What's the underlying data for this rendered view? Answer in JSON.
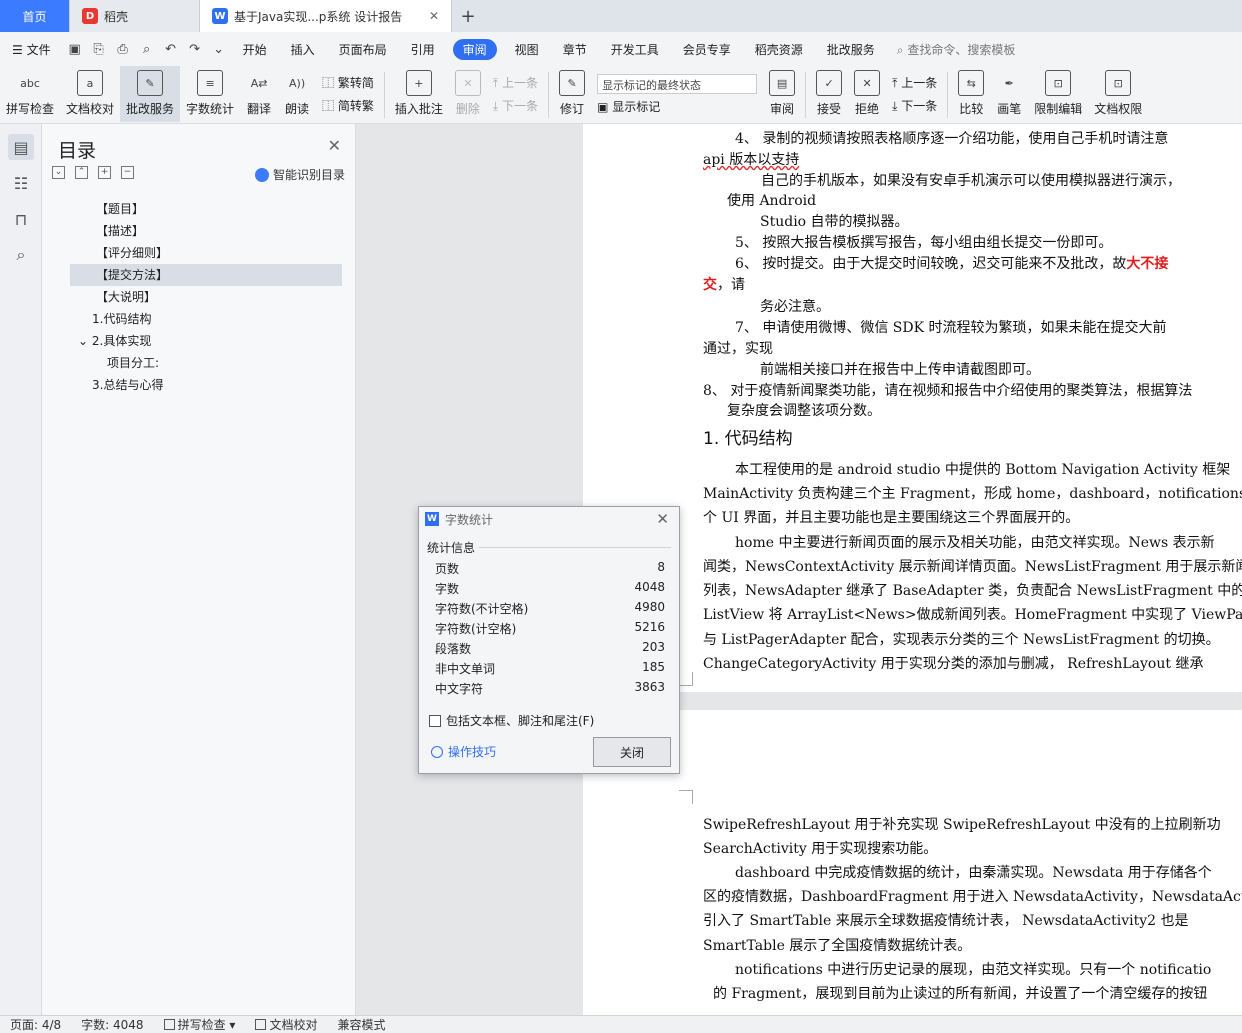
{
  "tabs": {
    "home": "首页",
    "daoke": "稻壳",
    "doc": "基于Java实现...p系统 设计报告"
  },
  "menu": {
    "file": "文件",
    "items": [
      "开始",
      "插入",
      "页面布局",
      "引用",
      "审阅",
      "视图",
      "章节",
      "开发工具",
      "会员专享",
      "稻壳资源",
      "批改服务"
    ],
    "active": "审阅",
    "search": "查找命令、搜索模板"
  },
  "ribbon": {
    "spell": "拼写检查",
    "proof": "文档校对",
    "review_service": "批改服务",
    "wordcount": "字数统计",
    "translate": "翻译",
    "read": "朗读",
    "to_trad": "繁转简",
    "to_simp": "简转繁",
    "insert_comment": "插入批注",
    "delete": "删除",
    "prev": "上一条",
    "next": "下一条",
    "revise": "修订",
    "show_mode": "显示标记的最终状态",
    "show_marks": "显示标记",
    "review": "审阅",
    "accept": "接受",
    "reject": "拒绝",
    "prev2": "上一条",
    "next2": "下一条",
    "compare": "比较",
    "pen": "画笔",
    "restrict": "限制编辑",
    "doc_perm": "文档权限"
  },
  "toc": {
    "title": "目录",
    "smart": "智能识别目录",
    "items": [
      "【题目】",
      "【描述】",
      "【评分细则】",
      "【提交方法】",
      "【大说明】",
      "1.代码结构",
      "2.具体实现",
      "项目分工:",
      "3.总结与心得"
    ]
  },
  "doc": {
    "p1": [
      "4、 录制的视频请按照表格顺序逐一介绍功能，使用自己手机时请注意",
      "api 版本以支持",
      "自己的手机版本，如果没有安卓手机演示可以使用模拟器进行演示，",
      "使用  Android",
      "Studio 自带的模拟器。",
      "5、  按照大报告模板撰写报告，每小组由组长提交一份即可。",
      "6、  按时提交。由于大提交时间较晚，迟交可能来不及批改，故",
      "大不接",
      "交",
      "，请",
      "务必注意。",
      "7、  申请使用微博、微信  SDK 时流程较为繁琐，如果未能在提交大前",
      "通过，实现",
      "前端相关接口并在报告中上传申请截图即可。",
      "8、  对于疫情新闻聚类功能，请在视频和报告中介绍使用的聚类算法，根据算法",
      "复杂度会调整该项分数。"
    ],
    "heading1": "1.  代码结构",
    "p2": [
      "本工程使用的是  android studio 中提供的  Bottom Navigation Activity 框架",
      "MainActivity 负责构建三个主  Fragment，形成 home，dashboard，notifications",
      "个 UI 界面，并且主要功能也是主要围绕这三个界面展开的。",
      "home 中主要进行新闻页面的展示及相关功能，由范文祥实现。News 表示新",
      "闻类，NewsContextActivity 展示新闻详情页面。NewsListFragment 用于展示新闻",
      "列表，NewsAdapter 继承了  BaseAdapter 类，负责配合  NewsListFragment 中的",
      "ListView 将 ArrayList<News>做成新闻列表。HomeFragment 中实现了  ViewPager",
      "与  ListPagerAdapter 配合，实现表示分类的三个  NewsListFragment 的切换。",
      "ChangeCategoryActivity 用于实现分类的添加与删减，  RefreshLayout 继承"
    ],
    "p3": [
      "SwipeRefreshLayout 用于补充实现  SwipeRefreshLayout 中没有的上拉刷新功",
      "SearchActivity 用于实现搜索功能。",
      "dashboard 中完成疫情数据的统计，由秦潇实现。Newsdata 用于存储各个",
      "区的疫情数据，DashboardFragment 用于进入  NewsdataActivity，NewsdataActiv",
      "引入了   SmartTable 来展示全球数据疫情统计表，    NewsdataActivity2 也是",
      "SmartTable 展示了全国疫情数据统计表。",
      "notifications 中进行历史记录的展现，由范文祥实现。只有一个  notificatio",
      "的 Fragment，展现到目前为止读过的所有新闻，并设置了一个清空缓存的按钮"
    ]
  },
  "dialog": {
    "title": "字数统计",
    "section": "统计信息",
    "rows": [
      {
        "label": "页数",
        "value": "8"
      },
      {
        "label": "字数",
        "value": "4048"
      },
      {
        "label": "字符数(不计空格)",
        "value": "4980"
      },
      {
        "label": "字符数(计空格)",
        "value": "5216"
      },
      {
        "label": "段落数",
        "value": "203"
      },
      {
        "label": "非中文单词",
        "value": "185"
      },
      {
        "label": "中文字符",
        "value": "3863"
      }
    ],
    "checkbox": "包括文本框、脚注和尾注(F)",
    "tips": "操作技巧",
    "close": "关闭"
  },
  "status": {
    "page": "页面: 4/8",
    "words": "字数: 4048",
    "spell": "拼写检查",
    "proof": "文档校对",
    "compat": "兼容模式"
  }
}
